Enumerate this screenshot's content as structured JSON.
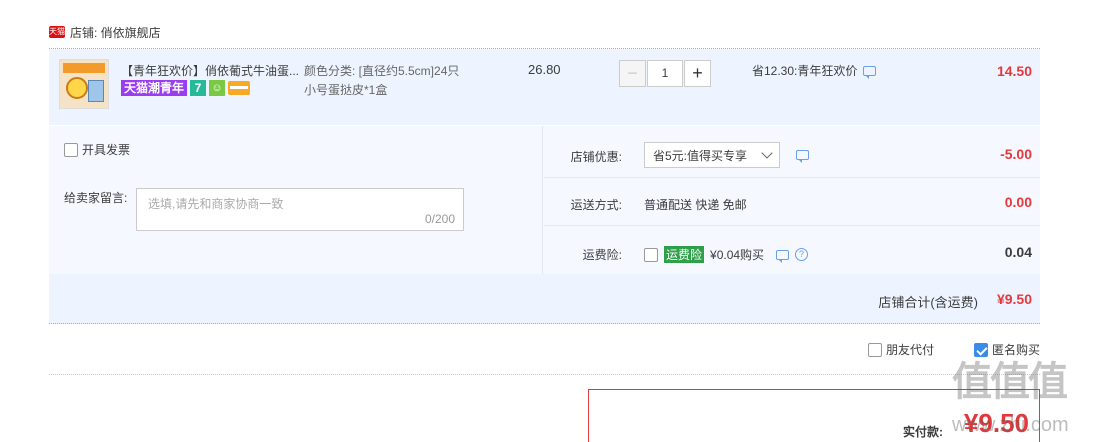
{
  "shop": {
    "badge": "天猫",
    "name": "店铺: 俏依旗舰店"
  },
  "item": {
    "title": "【青年狂欢价】俏依葡式牛油蛋...",
    "tags": [
      "天猫潮青年",
      "7"
    ],
    "spec_line1": "颜色分类: [直径约5.5cm]24只",
    "spec_line2": "小号蛋挞皮*1盒",
    "price": "26.80",
    "quantity": "1",
    "minus": "−",
    "plus": "+",
    "save": "省12.30:青年狂欢价",
    "total": "14.50"
  },
  "invoice": {
    "label": "开具发票"
  },
  "message": {
    "label": "给卖家留言:",
    "placeholder": "选填,请先和商家协商一致",
    "count": "0/200"
  },
  "discount": {
    "label": "店铺优惠:",
    "selected": "省5元:值得买专享",
    "value": "-5.00"
  },
  "shipping": {
    "label": "运送方式:",
    "text": "普通配送 快递 免邮",
    "value": "0.00"
  },
  "insurance": {
    "label": "运费险:",
    "badge": "运费险",
    "text": "¥0.04购买",
    "value": "0.04"
  },
  "subtotal": {
    "label": "店铺合计(含运费)",
    "value": "¥9.50"
  },
  "pay_options": {
    "friend": "朋友代付",
    "anonymous": "匿名购买"
  },
  "payment": {
    "label": "实付款:",
    "value": "¥9.50"
  },
  "watermark": {
    "logo": "值值值",
    "url": "www.zhi.com"
  },
  "colors": {
    "price_red": "#e4393c",
    "row_bg": "#eef4ff",
    "accent_blue": "#3b8be8"
  }
}
